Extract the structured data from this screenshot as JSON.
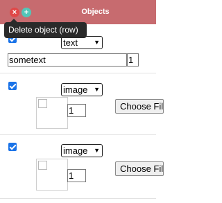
{
  "header": {
    "title": "Objects",
    "close_glyph": "×",
    "add_glyph": "+"
  },
  "tooltip": {
    "text": "Delete object (row)"
  },
  "rows": [
    {
      "checked": true,
      "type": "text",
      "text_value": "sometext",
      "count": "1"
    },
    {
      "checked": true,
      "type": "image",
      "count": "1",
      "choose_label": "Choose File"
    },
    {
      "checked": true,
      "type": "image",
      "count": "1",
      "choose_label": "Choose File"
    }
  ],
  "icons": {
    "close": "close-icon",
    "add": "plus-icon",
    "dropdown": "chevron-down-icon"
  },
  "colors": {
    "header_bg": "#c76b6f",
    "close": "#e04848",
    "add": "#53c6b8",
    "checkbox": "#1a73e8"
  }
}
